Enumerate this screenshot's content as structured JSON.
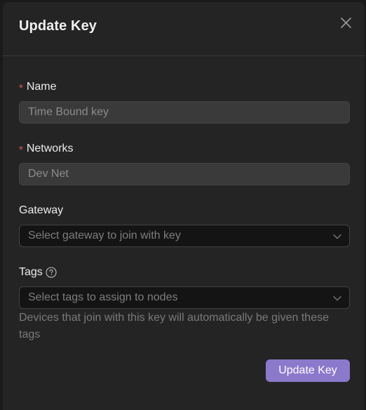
{
  "dialog": {
    "title": "Update Key",
    "close_icon": "close-icon"
  },
  "fields": {
    "name": {
      "label": "Name",
      "required_mark": "*",
      "value": "Time Bound key"
    },
    "networks": {
      "label": "Networks",
      "required_mark": "*",
      "value": "Dev Net"
    },
    "gateway": {
      "label": "Gateway",
      "placeholder": "Select gateway to join with key",
      "icon": "chevron-down-icon"
    },
    "tags": {
      "label": "Tags",
      "help_icon": "question-circle-icon",
      "placeholder": "Select tags to assign to nodes",
      "helper_text": "Devices that join with this key will automatically be given these tags",
      "icon": "chevron-down-icon"
    }
  },
  "actions": {
    "submit_label": "Update Key"
  },
  "colors": {
    "primary": "#8b79cc",
    "required": "#e05454",
    "dialog_bg": "#242424",
    "backdrop": "#1a1a1a"
  }
}
